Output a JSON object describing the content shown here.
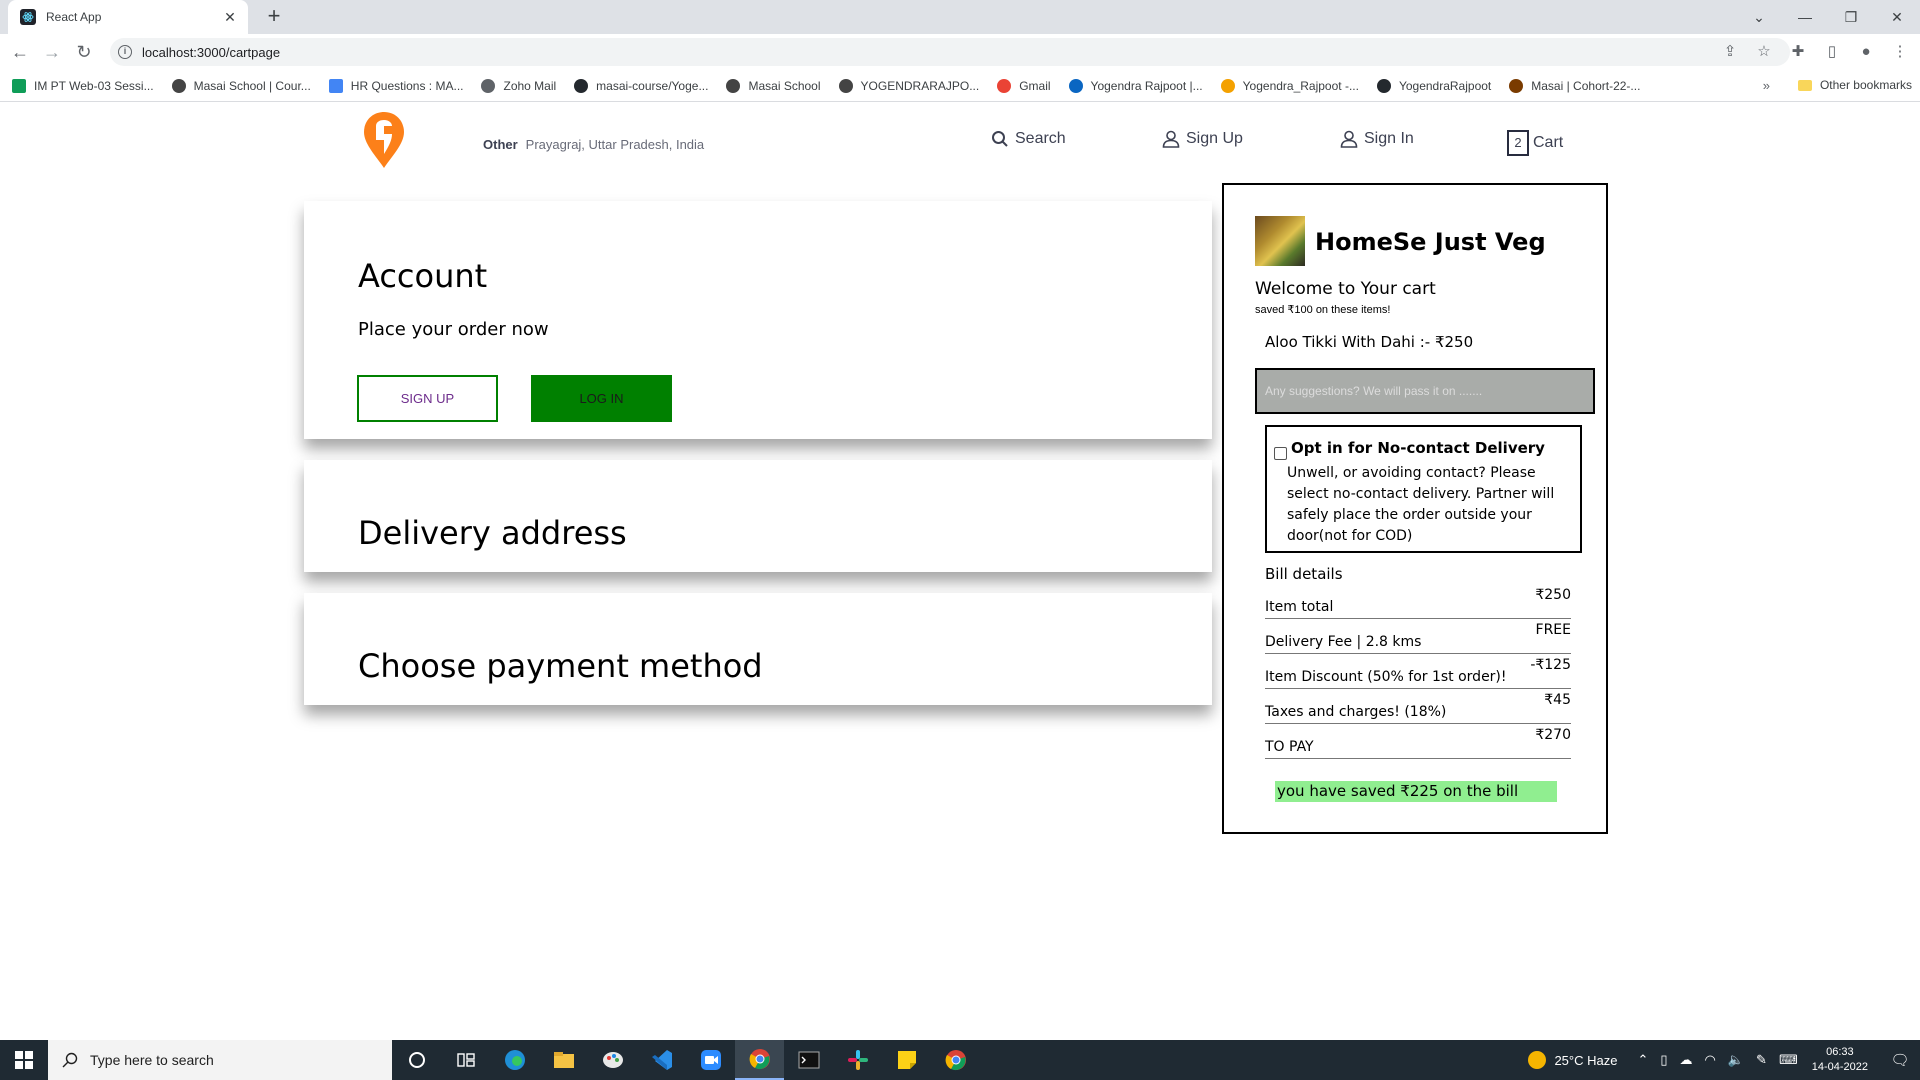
{
  "browser": {
    "tab_title": "React App",
    "url": "localhost:3000/cartpage",
    "bookmarks": [
      {
        "label": "IM PT Web-03 Sessi...",
        "color": "#0f9d58"
      },
      {
        "label": "Masai School | Cour...",
        "color": "#444444"
      },
      {
        "label": "HR Questions : MA...",
        "color": "#4285f4"
      },
      {
        "label": "Zoho Mail",
        "color": "#5f6368"
      },
      {
        "label": "masai-course/Yoge...",
        "color": "#24292e"
      },
      {
        "label": "Masai School",
        "color": "#444444"
      },
      {
        "label": "YOGENDRARAJPO...",
        "color": "#444444"
      },
      {
        "label": "Gmail",
        "color": "#ea4335"
      },
      {
        "label": "Yogendra Rajpoot |...",
        "color": "#0a66c2"
      },
      {
        "label": "Yogendra_Rajpoot -...",
        "color": "#f4a100"
      },
      {
        "label": "YogendraRajpoot",
        "color": "#24292e"
      },
      {
        "label": "Masai | Cohort-22-...",
        "color": "#7a3b00"
      }
    ],
    "more_bookmarks": "»",
    "other_bookmarks": "Other bookmarks"
  },
  "header": {
    "location_type": "Other",
    "location": "Prayagraj, Uttar Pradesh, India",
    "search_label": "Search",
    "signup_label": "Sign Up",
    "signin_label": "Sign In",
    "cart_count": "2",
    "cart_label": "Cart",
    "brand_color": "#fc8019"
  },
  "account": {
    "title": "Account",
    "subtitle": "Place your order now",
    "signup_button": "SIGN UP",
    "login_button": "LOG IN"
  },
  "delivery": {
    "title": "Delivery address"
  },
  "payment": {
    "title": "Choose payment method"
  },
  "cart": {
    "restaurant": "HomeSe Just Veg",
    "welcome": "Welcome to Your cart",
    "saved_note": "saved ₹100 on these items!",
    "item": "Aloo Tikki With Dahi :- ₹250",
    "suggestion_placeholder": "Any suggestions? We will pass it on .......",
    "no_contact_title": "Opt in for No-contact Delivery",
    "no_contact_desc": "Unwell, or avoiding contact? Please select no-contact delivery. Partner will safely place the order outside your door(not for COD)",
    "bill_title": "Bill details",
    "bill": [
      {
        "label": "Item total",
        "value": "₹250"
      },
      {
        "label": "Delivery Fee | 2.8 kms",
        "value": "FREE"
      },
      {
        "label": "Item Discount (50% for 1st order)!",
        "value": "-₹125"
      },
      {
        "label": "Taxes and charges! (18%)",
        "value": "₹45"
      },
      {
        "label": "TO PAY",
        "value": "₹270"
      }
    ],
    "saved_total": "you have saved ₹225 on the bill"
  },
  "taskbar": {
    "search_placeholder": "Type here to search",
    "weather": "25°C  Haze",
    "time": "06:33",
    "date": "14-04-2022"
  }
}
